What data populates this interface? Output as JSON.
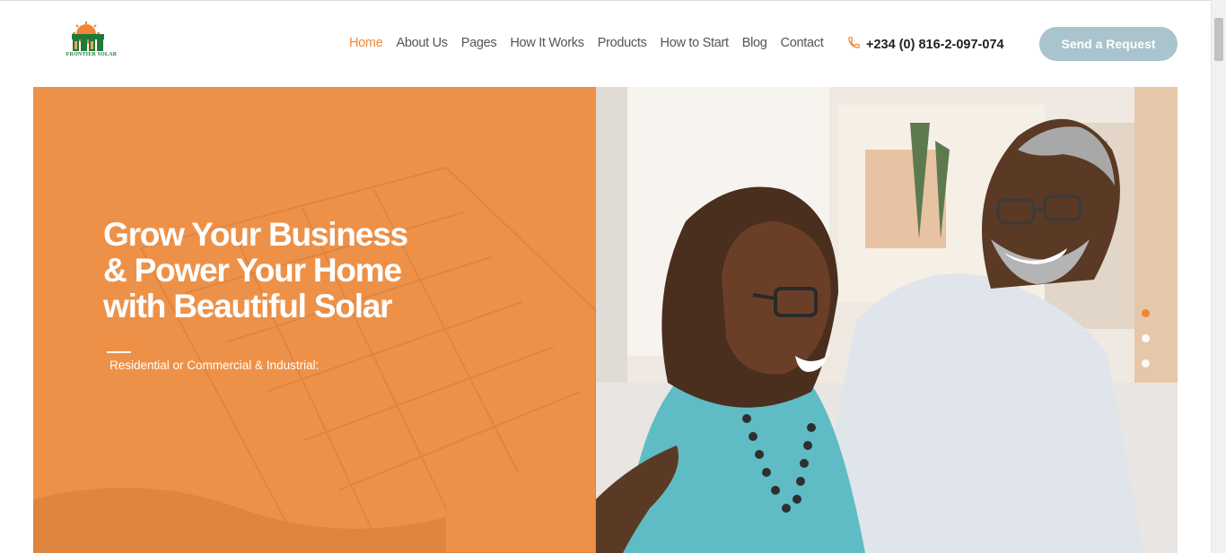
{
  "brand": {
    "logo_text": "FRONTIER SOLAR",
    "colors": {
      "accent": "#f0853a",
      "hero_bg": "#ee9148",
      "cta_bg": "#a9c4cd",
      "logo_green": "#1f7a3a"
    }
  },
  "nav": {
    "items": [
      {
        "label": "Home",
        "active": true
      },
      {
        "label": "About Us"
      },
      {
        "label": "Pages"
      },
      {
        "label": "How It Works"
      },
      {
        "label": "Products"
      },
      {
        "label": "How to Start"
      },
      {
        "label": "Blog"
      },
      {
        "label": "Contact"
      }
    ]
  },
  "header": {
    "phone": "+234 (0) 816-2-097-074",
    "phone_icon": "phone-icon",
    "cta_label": "Send a Request"
  },
  "hero": {
    "title_line1": "Grow Your Business",
    "title_line2": "& Power Your Home",
    "title_line3": "with Beautiful Solar",
    "subtitle": "Residential or Commercial & Industrial:",
    "image": "senior-couple-smiling-photo",
    "slides": {
      "count": 3,
      "active_index": 0
    }
  }
}
